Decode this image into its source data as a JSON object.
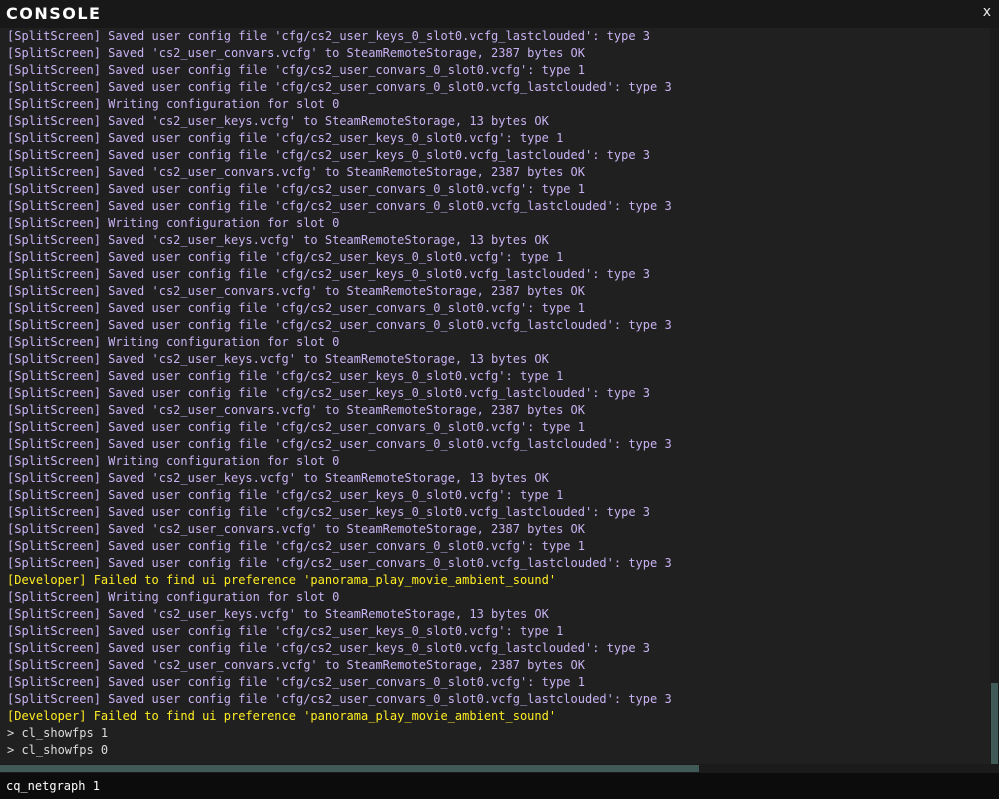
{
  "window": {
    "title": "CONSOLE",
    "close_label": "x"
  },
  "colors": {
    "split": "#c8b2f2",
    "developer": "#ffee22",
    "echo": "#dcdcdc",
    "accent": "#3f5a57"
  },
  "log": [
    {
      "text": "[SplitScreen] Saved user config file 'cfg/cs2_user_keys_0_slot0.vcfg_lastclouded': type 3",
      "kind": "split"
    },
    {
      "text": "[SplitScreen] Saved 'cs2_user_convars.vcfg' to SteamRemoteStorage, 2387 bytes OK",
      "kind": "split"
    },
    {
      "text": "[SplitScreen] Saved user config file 'cfg/cs2_user_convars_0_slot0.vcfg': type 1",
      "kind": "split"
    },
    {
      "text": "[SplitScreen] Saved user config file 'cfg/cs2_user_convars_0_slot0.vcfg_lastclouded': type 3",
      "kind": "split"
    },
    {
      "text": "[SplitScreen] Writing configuration for slot 0",
      "kind": "split"
    },
    {
      "text": "[SplitScreen] Saved 'cs2_user_keys.vcfg' to SteamRemoteStorage, 13 bytes OK",
      "kind": "split"
    },
    {
      "text": "[SplitScreen] Saved user config file 'cfg/cs2_user_keys_0_slot0.vcfg': type 1",
      "kind": "split"
    },
    {
      "text": "[SplitScreen] Saved user config file 'cfg/cs2_user_keys_0_slot0.vcfg_lastclouded': type 3",
      "kind": "split"
    },
    {
      "text": "[SplitScreen] Saved 'cs2_user_convars.vcfg' to SteamRemoteStorage, 2387 bytes OK",
      "kind": "split"
    },
    {
      "text": "[SplitScreen] Saved user config file 'cfg/cs2_user_convars_0_slot0.vcfg': type 1",
      "kind": "split"
    },
    {
      "text": "[SplitScreen] Saved user config file 'cfg/cs2_user_convars_0_slot0.vcfg_lastclouded': type 3",
      "kind": "split"
    },
    {
      "text": "[SplitScreen] Writing configuration for slot 0",
      "kind": "split"
    },
    {
      "text": "[SplitScreen] Saved 'cs2_user_keys.vcfg' to SteamRemoteStorage, 13 bytes OK",
      "kind": "split"
    },
    {
      "text": "[SplitScreen] Saved user config file 'cfg/cs2_user_keys_0_slot0.vcfg': type 1",
      "kind": "split"
    },
    {
      "text": "[SplitScreen] Saved user config file 'cfg/cs2_user_keys_0_slot0.vcfg_lastclouded': type 3",
      "kind": "split"
    },
    {
      "text": "[SplitScreen] Saved 'cs2_user_convars.vcfg' to SteamRemoteStorage, 2387 bytes OK",
      "kind": "split"
    },
    {
      "text": "[SplitScreen] Saved user config file 'cfg/cs2_user_convars_0_slot0.vcfg': type 1",
      "kind": "split"
    },
    {
      "text": "[SplitScreen] Saved user config file 'cfg/cs2_user_convars_0_slot0.vcfg_lastclouded': type 3",
      "kind": "split"
    },
    {
      "text": "[SplitScreen] Writing configuration for slot 0",
      "kind": "split"
    },
    {
      "text": "[SplitScreen] Saved 'cs2_user_keys.vcfg' to SteamRemoteStorage, 13 bytes OK",
      "kind": "split"
    },
    {
      "text": "[SplitScreen] Saved user config file 'cfg/cs2_user_keys_0_slot0.vcfg': type 1",
      "kind": "split"
    },
    {
      "text": "[SplitScreen] Saved user config file 'cfg/cs2_user_keys_0_slot0.vcfg_lastclouded': type 3",
      "kind": "split"
    },
    {
      "text": "[SplitScreen] Saved 'cs2_user_convars.vcfg' to SteamRemoteStorage, 2387 bytes OK",
      "kind": "split"
    },
    {
      "text": "[SplitScreen] Saved user config file 'cfg/cs2_user_convars_0_slot0.vcfg': type 1",
      "kind": "split"
    },
    {
      "text": "[SplitScreen] Saved user config file 'cfg/cs2_user_convars_0_slot0.vcfg_lastclouded': type 3",
      "kind": "split"
    },
    {
      "text": "[SplitScreen] Writing configuration for slot 0",
      "kind": "split"
    },
    {
      "text": "[SplitScreen] Saved 'cs2_user_keys.vcfg' to SteamRemoteStorage, 13 bytes OK",
      "kind": "split"
    },
    {
      "text": "[SplitScreen] Saved user config file 'cfg/cs2_user_keys_0_slot0.vcfg': type 1",
      "kind": "split"
    },
    {
      "text": "[SplitScreen] Saved user config file 'cfg/cs2_user_keys_0_slot0.vcfg_lastclouded': type 3",
      "kind": "split"
    },
    {
      "text": "[SplitScreen] Saved 'cs2_user_convars.vcfg' to SteamRemoteStorage, 2387 bytes OK",
      "kind": "split"
    },
    {
      "text": "[SplitScreen] Saved user config file 'cfg/cs2_user_convars_0_slot0.vcfg': type 1",
      "kind": "split"
    },
    {
      "text": "[SplitScreen] Saved user config file 'cfg/cs2_user_convars_0_slot0.vcfg_lastclouded': type 3",
      "kind": "split"
    },
    {
      "text": "[Developer] Failed to find ui preference 'panorama_play_movie_ambient_sound'",
      "kind": "developer"
    },
    {
      "text": "[SplitScreen] Writing configuration for slot 0",
      "kind": "split"
    },
    {
      "text": "[SplitScreen] Saved 'cs2_user_keys.vcfg' to SteamRemoteStorage, 13 bytes OK",
      "kind": "split"
    },
    {
      "text": "[SplitScreen] Saved user config file 'cfg/cs2_user_keys_0_slot0.vcfg': type 1",
      "kind": "split"
    },
    {
      "text": "[SplitScreen] Saved user config file 'cfg/cs2_user_keys_0_slot0.vcfg_lastclouded': type 3",
      "kind": "split"
    },
    {
      "text": "[SplitScreen] Saved 'cs2_user_convars.vcfg' to SteamRemoteStorage, 2387 bytes OK",
      "kind": "split"
    },
    {
      "text": "[SplitScreen] Saved user config file 'cfg/cs2_user_convars_0_slot0.vcfg': type 1",
      "kind": "split"
    },
    {
      "text": "[SplitScreen] Saved user config file 'cfg/cs2_user_convars_0_slot0.vcfg_lastclouded': type 3",
      "kind": "split"
    },
    {
      "text": "[Developer] Failed to find ui preference 'panorama_play_movie_ambient_sound'",
      "kind": "developer"
    },
    {
      "text": "> cl_showfps 1",
      "kind": "echo"
    },
    {
      "text": "> cl_showfps 0",
      "kind": "echo"
    }
  ],
  "input": {
    "value": "cq_netgraph 1"
  }
}
